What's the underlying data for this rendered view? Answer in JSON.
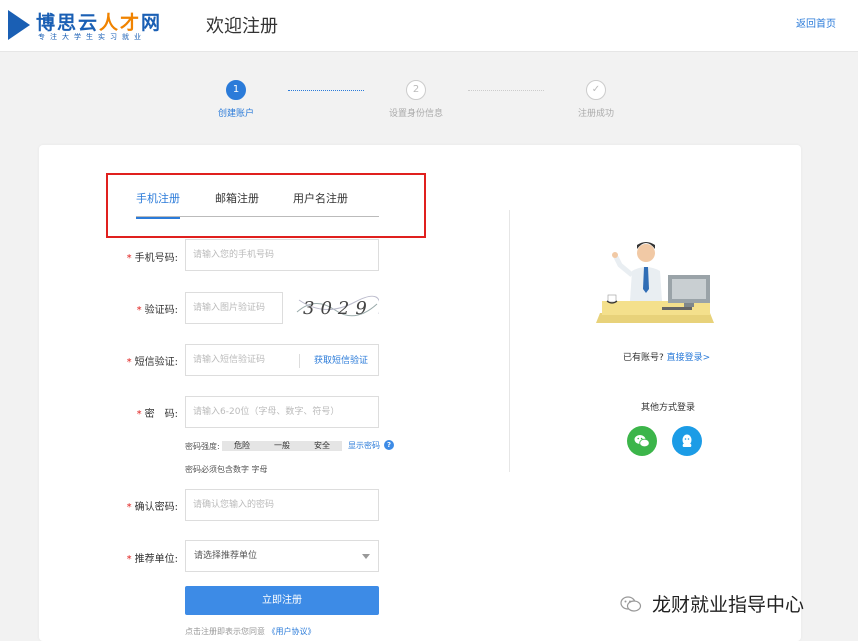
{
  "header": {
    "logo_name_blue": "博思云",
    "logo_name_orange": "人才",
    "logo_name_end": "网",
    "logo_sub": "专注大学生实习就业",
    "title": "欢迎注册",
    "back_link": "返回首页"
  },
  "steps": [
    {
      "number": "1",
      "label": "创建账户",
      "state": "active"
    },
    {
      "number": "2",
      "label": "设置身份信息",
      "state": "pending"
    },
    {
      "number": "✓",
      "label": "注册成功",
      "state": "pending"
    }
  ],
  "tabs": [
    {
      "label": "手机注册",
      "active": true
    },
    {
      "label": "邮箱注册",
      "active": false
    },
    {
      "label": "用户名注册",
      "active": false
    }
  ],
  "form": {
    "required_mark": "*",
    "phone": {
      "label": "手机号码:",
      "placeholder": "请输入您的手机号码"
    },
    "captcha": {
      "label": "验证码:",
      "placeholder": "请输入图片验证码",
      "image_text": "3029"
    },
    "sms": {
      "label": "短信验证:",
      "placeholder": "请输入短信验证码",
      "button": "获取短信验证"
    },
    "password": {
      "label": "密　码:",
      "placeholder": "请输入6-20位（字母、数字、符号）"
    },
    "strength": {
      "label": "密码强度:",
      "levels": [
        "危险",
        "一般",
        "安全"
      ],
      "show_password": "显示密码",
      "help": "?"
    },
    "password_hint": "密码必须包含数字 字母",
    "confirm": {
      "label": "确认密码:",
      "placeholder": "请确认您输入的密码"
    },
    "referrer": {
      "label": "推荐单位:",
      "selected": "请选择推荐单位"
    },
    "submit": "立即注册",
    "agree_text": "点击注册即表示您同意",
    "agree_link": "《用户协议》"
  },
  "side": {
    "has_account": "已有账号?",
    "login_link": "直接登录>",
    "other_login": "其他方式登录",
    "social": [
      "wechat-icon",
      "qq-icon"
    ]
  },
  "watermark": "龙财就业指导中心",
  "colors": {
    "primary": "#2b7bd9",
    "button": "#3d8be6",
    "highlight": "#e0201e",
    "wechat": "#3cb54a",
    "qq": "#1c9ce6"
  }
}
